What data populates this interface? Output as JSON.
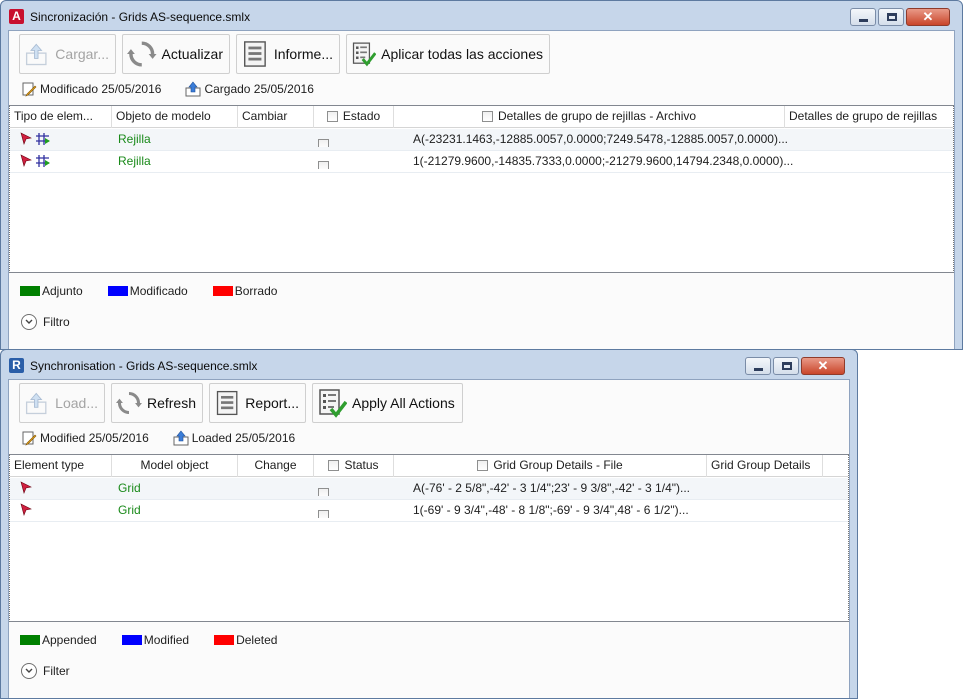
{
  "window1": {
    "title": "Sincronización - Grids AS-sequence.smlx",
    "app_icon": "A",
    "close_glyph": "✕",
    "toolbar": {
      "load_label": "Cargar...",
      "refresh_label": "Actualizar",
      "report_label": "Informe...",
      "apply_label": "Aplicar todas las acciones"
    },
    "info": {
      "modified": "Modificado 25/05/2016",
      "loaded": "Cargado 25/05/2016"
    },
    "columns": {
      "element_type": "Tipo de elem...",
      "model_object": "Objeto de modelo",
      "change": "Cambiar",
      "status": "Estado",
      "details_file": "Detalles de grupo de rejillas - Archivo",
      "details": "Detalles de grupo de rejillas"
    },
    "rows": [
      {
        "model_object": "Rejilla",
        "details_file": "A(-23231.1463,-12885.0057,0.0000;7249.5478,-12885.0057,0.0000)..."
      },
      {
        "model_object": "Rejilla",
        "details_file": "1(-21279.9600,-14835.7333,0.0000;-21279.9600,14794.2348,0.0000)..."
      }
    ],
    "legend": {
      "appended": "Adjunto",
      "modified": "Modificado",
      "deleted": "Borrado"
    },
    "filter_label": "Filtro"
  },
  "window2": {
    "title": "Synchronisation - Grids AS-sequence.smlx",
    "app_icon": "R",
    "close_glyph": "✕",
    "toolbar": {
      "load_label": "Load...",
      "refresh_label": "Refresh",
      "report_label": "Report...",
      "apply_label": "Apply All Actions"
    },
    "info": {
      "modified": "Modified 25/05/2016",
      "loaded": "Loaded 25/05/2016"
    },
    "columns": {
      "element_type": "Element type",
      "model_object": "Model object",
      "change": "Change",
      "status": "Status",
      "details_file": "Grid Group Details - File",
      "details": "Grid Group Details"
    },
    "rows": [
      {
        "model_object": "Grid",
        "details_file": "A(-76' - 2 5/8\",-42' - 3 1/4\";23' - 9 3/8\",-42' - 3 1/4\")..."
      },
      {
        "model_object": "Grid",
        "details_file": "1(-69' - 9 3/4\",-48' - 8 1/8\";-69' - 9 3/4\",48' - 6 1/2\")..."
      }
    ],
    "legend": {
      "appended": "Appended",
      "modified": "Modified",
      "deleted": "Deleted"
    },
    "filter_label": "Filter"
  },
  "colors": {
    "appended": "#008000",
    "modified": "#0000ff",
    "deleted": "#ff0000",
    "object_text": "#1a8a1a"
  },
  "icons": {
    "load": "load-arrow-icon",
    "refresh": "refresh-icon",
    "report": "report-icon",
    "apply": "apply-checklist-icon",
    "modified": "pencil-document-icon",
    "loaded": "upload-document-icon",
    "element_type": "select-arrow-icon",
    "grid_type": "grid-icon",
    "filter": "chevron-down-circle-icon"
  }
}
